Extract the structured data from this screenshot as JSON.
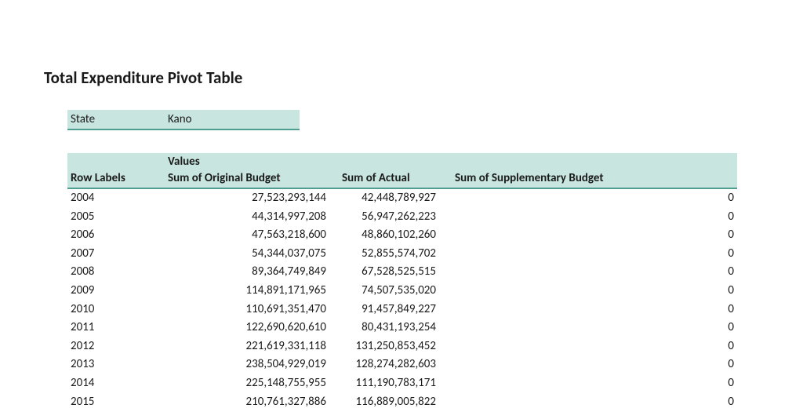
{
  "title": "Total Expenditure Pivot Table",
  "filter": {
    "label": "State",
    "value": "Kano"
  },
  "values_header": "Values",
  "columns": {
    "row_labels": "Row Labels",
    "original": "Sum of Original Budget",
    "actual": "Sum of Actual",
    "supplementary": "Sum of Supplementary Budget"
  },
  "rows": [
    {
      "year": "2004",
      "original": "27,523,293,144",
      "actual": "42,448,789,927",
      "supplementary": "0"
    },
    {
      "year": "2005",
      "original": "44,314,997,208",
      "actual": "56,947,262,223",
      "supplementary": "0"
    },
    {
      "year": "2006",
      "original": "47,563,218,600",
      "actual": "48,860,102,260",
      "supplementary": "0"
    },
    {
      "year": "2007",
      "original": "54,344,037,075",
      "actual": "52,855,574,702",
      "supplementary": "0"
    },
    {
      "year": "2008",
      "original": "89,364,749,849",
      "actual": "67,528,525,515",
      "supplementary": "0"
    },
    {
      "year": "2009",
      "original": "114,891,171,965",
      "actual": "74,507,535,020",
      "supplementary": "0"
    },
    {
      "year": "2010",
      "original": "110,691,351,470",
      "actual": "91,457,849,227",
      "supplementary": "0"
    },
    {
      "year": "2011",
      "original": "122,690,620,610",
      "actual": "80,431,193,254",
      "supplementary": "0"
    },
    {
      "year": "2012",
      "original": "221,619,331,118",
      "actual": "131,250,853,452",
      "supplementary": "0"
    },
    {
      "year": "2013",
      "original": "238,504,929,019",
      "actual": "128,274,282,603",
      "supplementary": "0"
    },
    {
      "year": "2014",
      "original": "225,148,755,955",
      "actual": "111,190,783,171",
      "supplementary": "0"
    },
    {
      "year": "2015",
      "original": "210,761,327,886",
      "actual": "116,889,005,822",
      "supplementary": "0"
    }
  ]
}
